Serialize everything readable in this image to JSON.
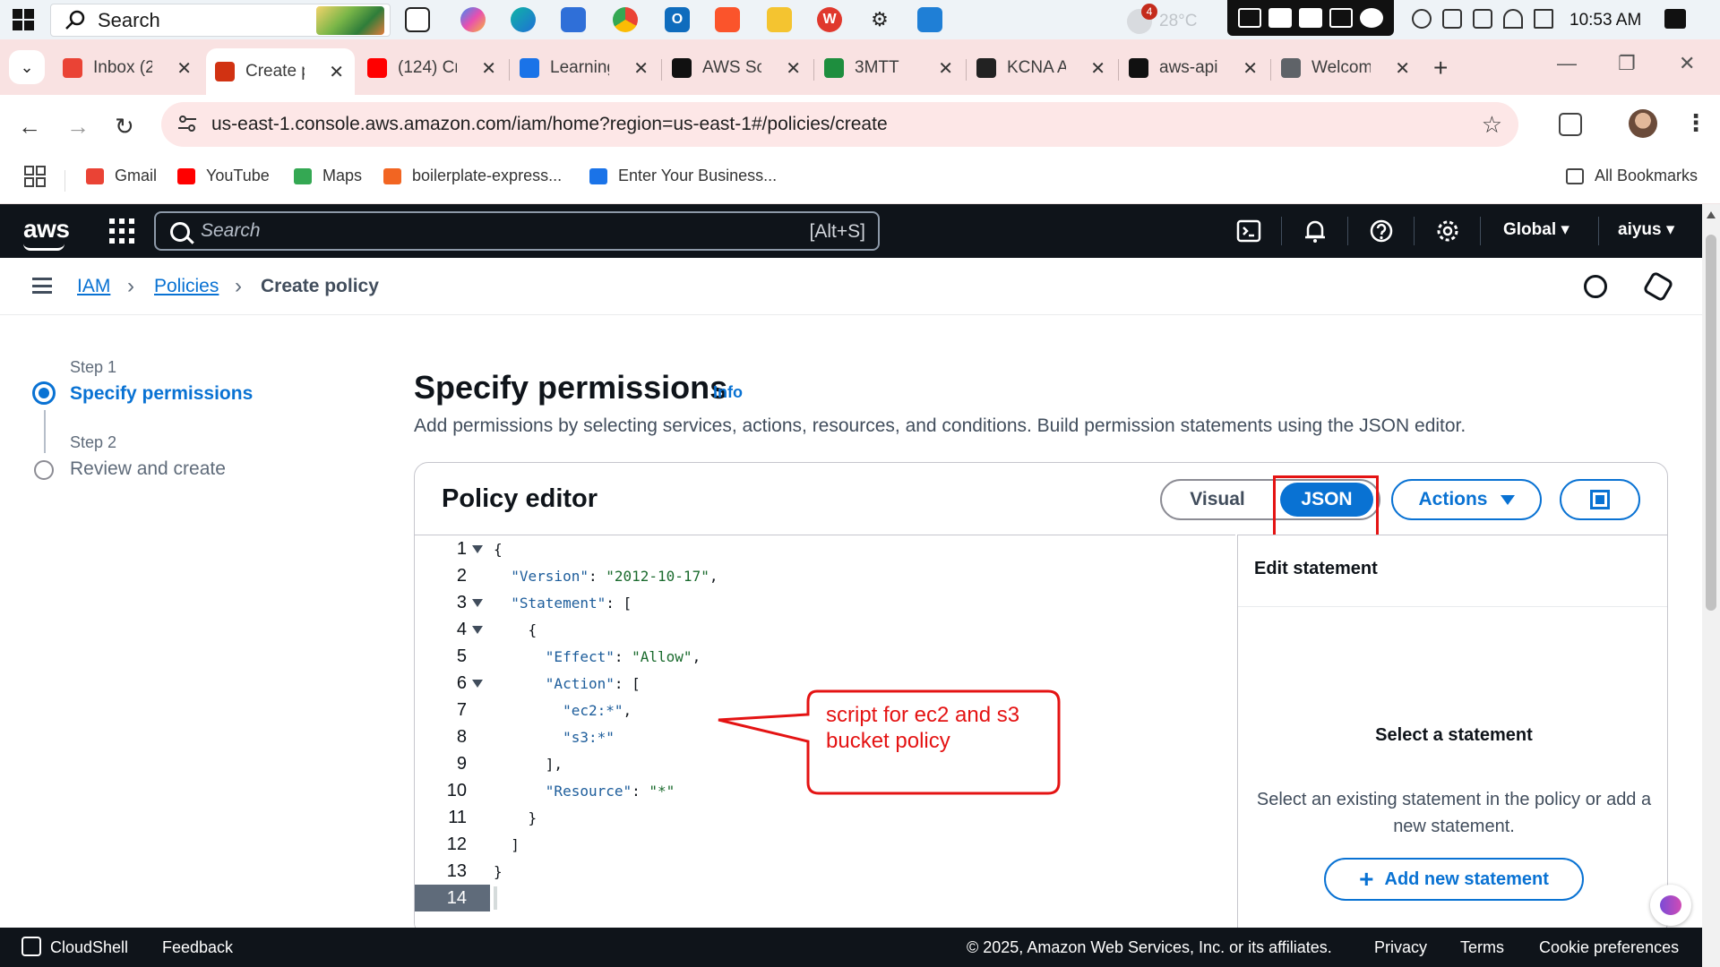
{
  "taskbar": {
    "search_placeholder": "Search",
    "weather_temp": "28°C",
    "weather_badge": "4",
    "clock": "10:53 AM",
    "apps": [
      "task-view-icon",
      "copilot-icon",
      "edge-icon",
      "store-icon",
      "chrome-icon",
      "outlook-icon",
      "brave-icon",
      "file-explorer-icon",
      "wps-icon",
      "settings-icon",
      "vscode-icon"
    ]
  },
  "browser": {
    "tabs": [
      {
        "label": "Inbox (2",
        "icon": "gmail-icon",
        "color": "#ea4335"
      },
      {
        "label": "Create p",
        "icon": "aws-tab-icon",
        "color": "#d13212",
        "active": true
      },
      {
        "label": "(124) Cr",
        "icon": "youtube-icon",
        "color": "#ff0000"
      },
      {
        "label": "Learning",
        "icon": "learning-icon",
        "color": "#1a73e8"
      },
      {
        "label": "AWS Sc",
        "icon": "openai-icon",
        "color": "#111111"
      },
      {
        "label": "3MTT",
        "icon": "3mtt-icon",
        "color": "#1e8e3e"
      },
      {
        "label": "KCNA A",
        "icon": "kcna-icon",
        "color": "#222222"
      },
      {
        "label": "aws-api",
        "icon": "github-icon",
        "color": "#111111"
      },
      {
        "label": "Welcom",
        "icon": "globe-icon",
        "color": "#5f6368"
      }
    ],
    "url": "us-east-1.console.aws.amazon.com/iam/home?region=us-east-1#/policies/create",
    "bookmarks": [
      {
        "label": "Gmail",
        "color": "#ea4335"
      },
      {
        "label": "YouTube",
        "color": "#ff0000"
      },
      {
        "label": "Maps",
        "color": "#34a853"
      },
      {
        "label": "boilerplate-express...",
        "color": "#f26522"
      },
      {
        "label": "Enter Your Business...",
        "color": "#1a73e8"
      }
    ],
    "all_bookmarks": "All Bookmarks"
  },
  "aws": {
    "logo": "aws",
    "search_placeholder": "Search",
    "search_shortcut": "[Alt+S]",
    "region": "Global",
    "user": "aiyus",
    "breadcrumbs": [
      "IAM",
      "Policies",
      "Create policy"
    ],
    "steps": [
      {
        "label": "Step 1",
        "title": "Specify permissions"
      },
      {
        "label": "Step 2",
        "title": "Review and create"
      }
    ],
    "page_title": "Specify permissions",
    "info": "Info",
    "page_desc": "Add permissions by selecting services, actions, resources, and conditions. Build permission statements using the JSON editor.",
    "editor": {
      "title": "Policy editor",
      "mode_visual": "Visual",
      "mode_json": "JSON",
      "actions": "Actions",
      "line_numbers": [
        "1",
        "2",
        "3",
        "4",
        "5",
        "6",
        "7",
        "8",
        "9",
        "10",
        "11",
        "12",
        "13",
        "14"
      ],
      "code": [
        "{",
        "  \"Version\": \"2012-10-17\",",
        "  \"Statement\": [",
        "    {",
        "      \"Effect\": \"Allow\",",
        "      \"Action\": [",
        "        \"ec2:*\",",
        "        \"s3:*\"",
        "      ],",
        "      \"Resource\": \"*\"",
        "    }",
        "  ]",
        "}",
        ""
      ],
      "side_title": "Edit statement",
      "side_select": "Select a statement",
      "side_desc": "Select an existing statement in the policy or add a new statement.",
      "add_statement": "Add new statement"
    },
    "annotation": "script for ec2 and s3 bucket policy",
    "footer": {
      "cloudshell": "CloudShell",
      "feedback": "Feedback",
      "copyright": "© 2025, Amazon Web Services, Inc. or its affiliates.",
      "privacy": "Privacy",
      "terms": "Terms",
      "cookies": "Cookie preferences"
    }
  },
  "colors": {
    "aws_dark": "#0f141a",
    "aws_blue": "#0972d3",
    "annotation_red": "#e41313",
    "tab_strip": "#f9e2e2"
  }
}
